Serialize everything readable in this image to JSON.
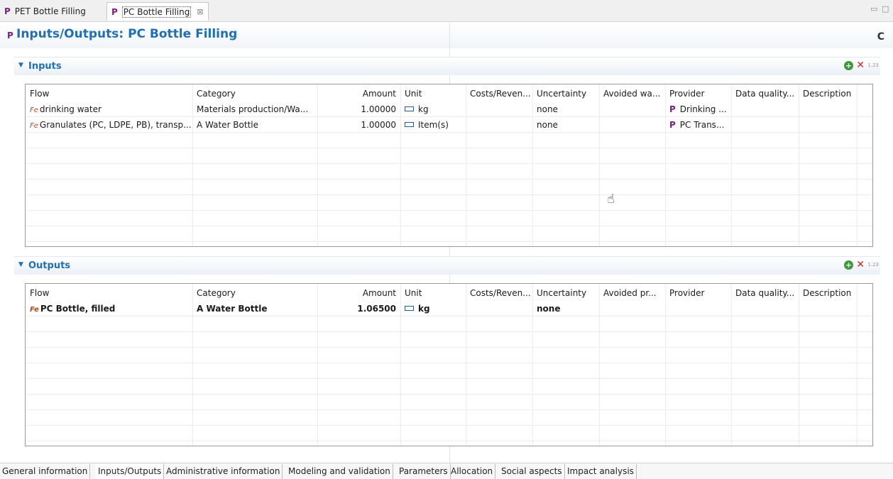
{
  "tabs": [
    {
      "label": "PET Bottle Filling",
      "icon": "P",
      "active": false
    },
    {
      "label": "PC Bottle Filling",
      "icon": "P",
      "active": true,
      "close": "⊠"
    }
  ],
  "window_controls": {
    "minimize": "▭",
    "maximize": "□"
  },
  "page": {
    "icon": "P",
    "title": "Inputs/Outputs: PC Bottle Filling",
    "refresh": "C"
  },
  "inputs": {
    "title": "Inputs",
    "columns": [
      "Flow",
      "Category",
      "Amount",
      "Unit",
      "Costs/Reven...",
      "Uncertainty",
      "Avoided wa...",
      "Provider",
      "Data quality...",
      "Description"
    ],
    "rows": [
      {
        "flow": "drinking water",
        "category": "Materials production/Wa...",
        "amount": "1.00000",
        "unit": "kg",
        "costs": "",
        "uncertainty": "none",
        "avoided": "",
        "provider": "Drinking ...",
        "dq": "",
        "desc": ""
      },
      {
        "flow": "Granulates (PC, LDPE, PB), transp...",
        "category": "A Water Bottle",
        "amount": "1.00000",
        "unit": "Item(s)",
        "costs": "",
        "uncertainty": "none",
        "avoided": "",
        "provider": "PC Trans...",
        "dq": "",
        "desc": ""
      }
    ]
  },
  "outputs": {
    "title": "Outputs",
    "columns": [
      "Flow",
      "Category",
      "Amount",
      "Unit",
      "Costs/Reven...",
      "Uncertainty",
      "Avoided pr...",
      "Provider",
      "Data quality...",
      "Description"
    ],
    "rows": [
      {
        "flow": "PC Bottle, filled",
        "category": "A Water Bottle",
        "amount": "1.06500",
        "unit": "kg",
        "costs": "",
        "uncertainty": "none",
        "avoided": "",
        "provider": "",
        "dq": "",
        "desc": ""
      }
    ]
  },
  "section_icons": {
    "format": "1.23"
  },
  "bottom_tabs": [
    "General information",
    "Inputs/Outputs",
    "Administrative information",
    "Modeling and validation",
    "Parameters",
    "Allocation",
    "Social aspects",
    "Impact analysis"
  ],
  "bottom_active": "Inputs/Outputs",
  "colors": {
    "accent": "#1f6fb7",
    "process": "#7a1f80",
    "flow": "#b44a1e",
    "add": "#3a9a3a",
    "delete": "#dd2222"
  }
}
